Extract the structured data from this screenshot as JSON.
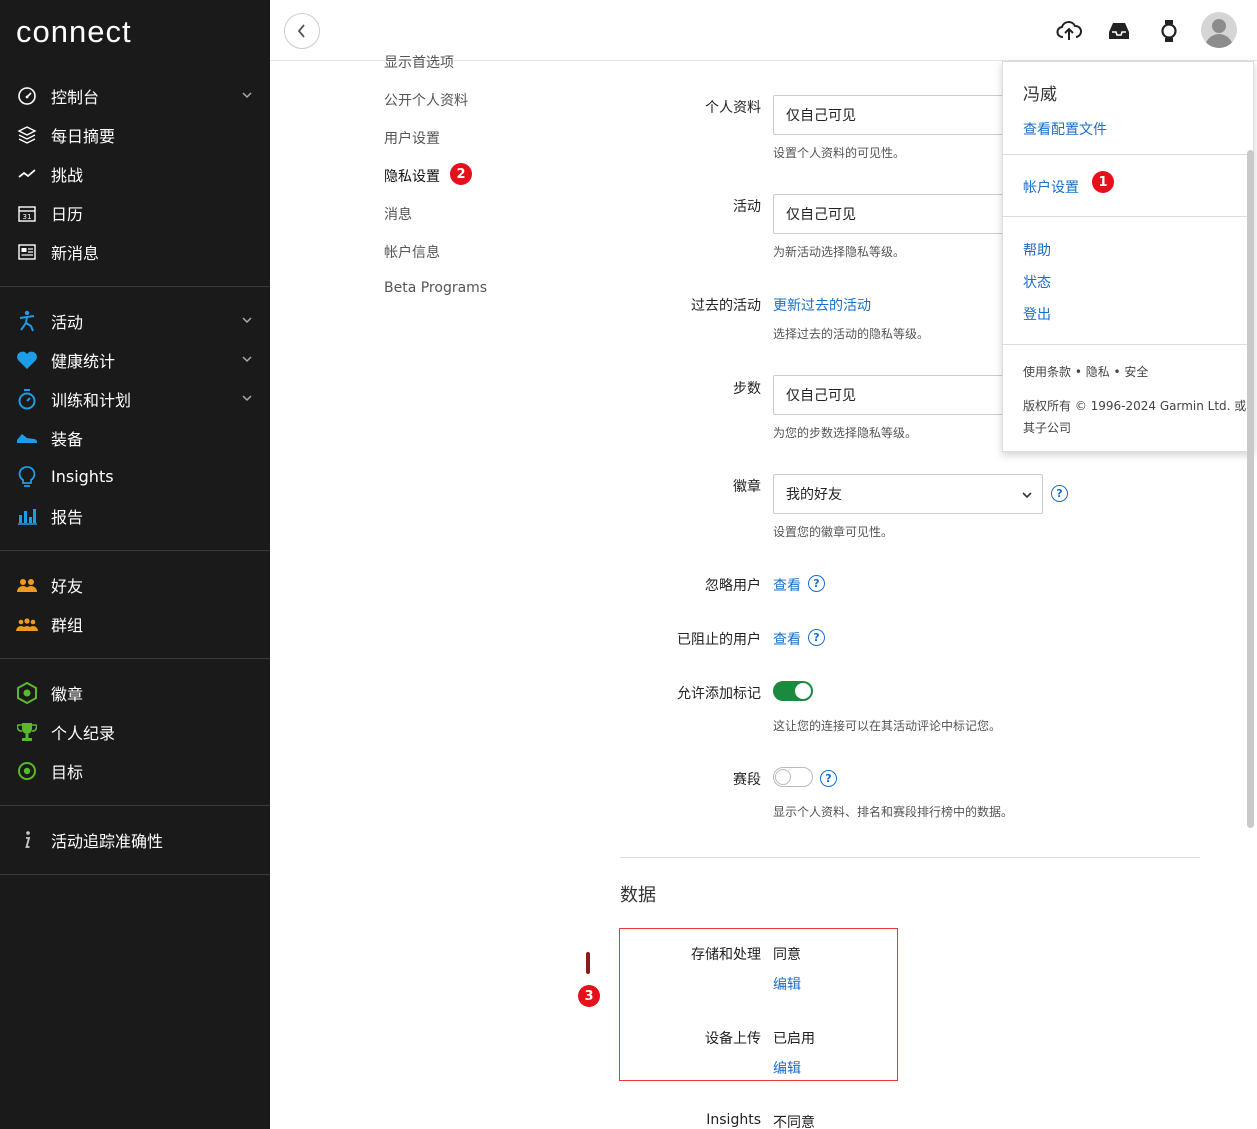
{
  "logo": "connect",
  "sidebar": {
    "groups": [
      [
        {
          "label": "控制台",
          "icon": "dashboard-gauge-icon",
          "chevron": true
        },
        {
          "label": "每日摘要",
          "icon": "layers-icon",
          "chevron": false
        },
        {
          "label": "挑战",
          "icon": "challenge-icon",
          "chevron": false
        },
        {
          "label": "日历",
          "icon": "calendar-icon",
          "chevron": false
        },
        {
          "label": "新消息",
          "icon": "newsfeed-icon",
          "chevron": false
        }
      ],
      [
        {
          "label": "活动",
          "icon": "runner-icon",
          "chevron": true
        },
        {
          "label": "健康统计",
          "icon": "heart-icon",
          "chevron": true
        },
        {
          "label": "训练和计划",
          "icon": "stopwatch-icon",
          "chevron": true
        },
        {
          "label": "装备",
          "icon": "shoe-icon",
          "chevron": false
        },
        {
          "label": "Insights",
          "icon": "lightbulb-icon",
          "chevron": false
        },
        {
          "label": "报告",
          "icon": "bar-chart-icon",
          "chevron": false
        }
      ],
      [
        {
          "label": "好友",
          "icon": "friends-icon",
          "chevron": false
        },
        {
          "label": "群组",
          "icon": "groups-icon",
          "chevron": false
        }
      ],
      [
        {
          "label": "徽章",
          "icon": "badge-hex-icon",
          "chevron": false
        },
        {
          "label": "个人纪录",
          "icon": "trophy-icon",
          "chevron": false
        },
        {
          "label": "目标",
          "icon": "target-icon",
          "chevron": false
        }
      ],
      [
        {
          "label": "活动追踪准确性",
          "icon": "info-icon",
          "chevron": false
        }
      ]
    ]
  },
  "settings_nav": {
    "items": [
      "显示首选项",
      "公开个人资料",
      "用户设置",
      "隐私设置",
      "消息",
      "帐户信息",
      "Beta Programs"
    ],
    "active_index": 3
  },
  "privacy": {
    "profile": {
      "label": "个人资料",
      "value": "仅自己可见",
      "hint": "设置个人资料的可见性。"
    },
    "activities": {
      "label": "活动",
      "value": "仅自己可见",
      "hint": "为新活动选择隐私等级。"
    },
    "past_activities": {
      "label": "过去的活动",
      "link": "更新过去的活动",
      "hint": "选择过去的活动的隐私等级。"
    },
    "steps": {
      "label": "步数",
      "value": "仅自己可见",
      "hint": "为您的步数选择隐私等级。"
    },
    "badges": {
      "label": "徽章",
      "value": "我的好友",
      "hint": "设置您的徽章可见性。"
    },
    "ignored_users": {
      "label": "忽略用户",
      "link": "查看"
    },
    "blocked_users": {
      "label": "已阻止的用户",
      "link": "查看"
    },
    "allow_tagging": {
      "label": "允许添加标记",
      "enabled": true,
      "hint": "这让您的连接可以在其活动评论中标记您。"
    },
    "segments": {
      "label": "赛段",
      "enabled": false,
      "hint": "显示个人资料、排名和赛段排行榜中的数据。"
    }
  },
  "data_section": {
    "title": "数据",
    "storage": {
      "label": "存储和处理",
      "value": "同意",
      "edit": "编辑"
    },
    "device_upload": {
      "label": "设备上传",
      "value": "已启用",
      "edit": "编辑"
    },
    "insights": {
      "label": "Insights",
      "value": "不同意"
    }
  },
  "account_menu": {
    "user_name": "冯威",
    "view_profile": "查看配置文件",
    "account_settings": "帐户设置",
    "help": "帮助",
    "status": "状态",
    "logout": "登出",
    "legal": "使用条款 • 隐私 • 安全",
    "copyright_line1": "版权所有 © 1996-2024 Garmin Ltd. 或",
    "copyright_line2": "其子公司"
  },
  "badges": {
    "one": "1",
    "two": "2",
    "three": "3"
  },
  "colors": {
    "accent_blue": "#1a6fc9",
    "toggle_on": "#1a8a3c",
    "badge_red": "#e5101b",
    "sidebar_bg": "#1a1a1a"
  }
}
